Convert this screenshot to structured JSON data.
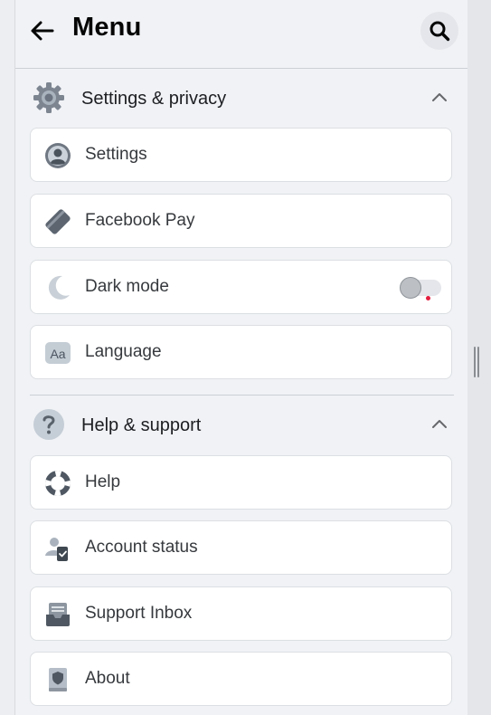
{
  "header": {
    "title": "Menu",
    "back_icon": "arrow-left-icon",
    "search_icon": "search-icon"
  },
  "sections": [
    {
      "label": "Settings & privacy",
      "icon": "gear-icon",
      "expanded": true,
      "items": [
        {
          "label": "Settings",
          "icon": "user-circle-icon"
        },
        {
          "label": "Facebook Pay",
          "icon": "card-icon"
        },
        {
          "label": "Dark mode",
          "icon": "moon-icon",
          "toggle_on": false
        },
        {
          "label": "Language",
          "icon": "language-aa-icon"
        }
      ]
    },
    {
      "label": "Help & support",
      "icon": "question-icon",
      "expanded": true,
      "items": [
        {
          "label": "Help",
          "icon": "lifebuoy-icon"
        },
        {
          "label": "Account status",
          "icon": "account-status-icon"
        },
        {
          "label": "Support Inbox",
          "icon": "inbox-icon"
        },
        {
          "label": "About",
          "icon": "book-icon"
        }
      ]
    }
  ],
  "colors": {
    "panel_bg": "#f0f2f5",
    "card_bg": "#ffffff",
    "text": "#1c1e21",
    "notification_dot": "#e41e3f"
  }
}
